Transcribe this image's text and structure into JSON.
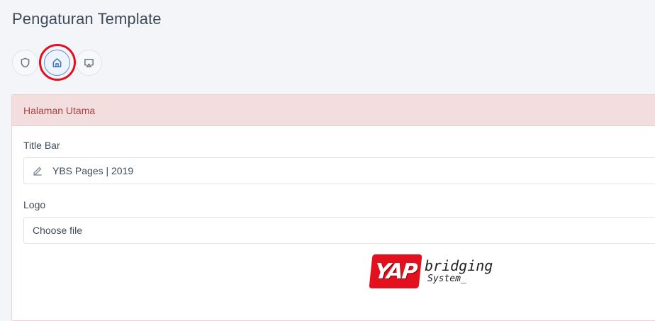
{
  "page": {
    "title": "Pengaturan Template"
  },
  "tabs": [
    {
      "icon": "shield-icon",
      "active": false
    },
    {
      "icon": "home-icon",
      "active": true
    },
    {
      "icon": "monitor-icon",
      "active": false
    }
  ],
  "card": {
    "header": "Halaman Utama",
    "title_bar": {
      "label": "Title Bar",
      "value": "YBS Pages | 2019",
      "icon": "pencil-icon"
    },
    "logo": {
      "label": "Logo",
      "file_placeholder": "Choose file"
    },
    "logo_image": {
      "badge_text": "YAP",
      "line1": "bridging",
      "line2": "System_"
    }
  },
  "colors": {
    "header_bg": "#f2dede",
    "header_text": "#a94442",
    "highlight_ring": "#e01020",
    "logo_red": "#e3101d"
  }
}
